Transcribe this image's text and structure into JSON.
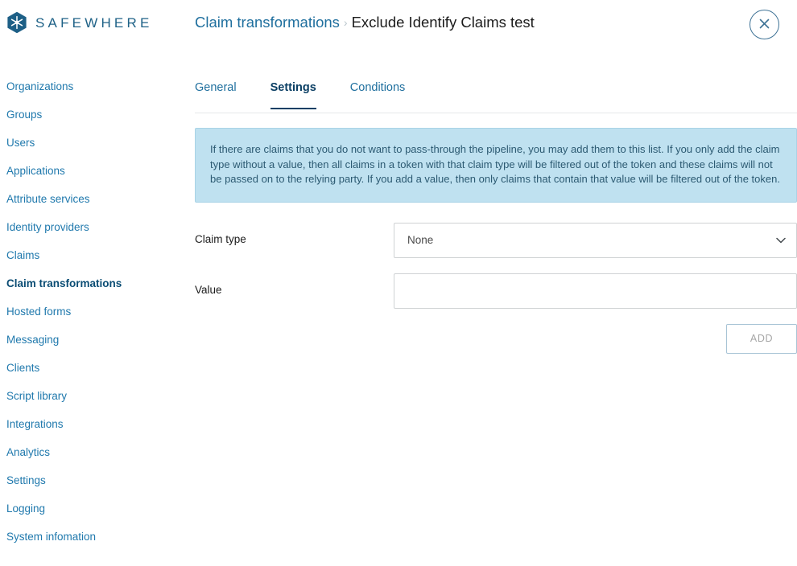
{
  "brand": {
    "logo_icon": "safewhere-hexagon-snowflake-icon",
    "wordmark": "SAFEWHERE"
  },
  "header": {
    "breadcrumb": {
      "parent": "Claim transformations",
      "separator": "›",
      "current": "Exclude Identify Claims test"
    },
    "close_icon": "close-icon"
  },
  "sidebar": {
    "items": [
      {
        "label": "Organizations",
        "active": false
      },
      {
        "label": "Groups",
        "active": false
      },
      {
        "label": "Users",
        "active": false
      },
      {
        "label": "Applications",
        "active": false
      },
      {
        "label": "Attribute services",
        "active": false
      },
      {
        "label": "Identity providers",
        "active": false
      },
      {
        "label": "Claims",
        "active": false
      },
      {
        "label": "Claim transformations",
        "active": true
      },
      {
        "label": "Hosted forms",
        "active": false
      },
      {
        "label": "Messaging",
        "active": false
      },
      {
        "label": "Clients",
        "active": false
      },
      {
        "label": "Script library",
        "active": false
      },
      {
        "label": "Integrations",
        "active": false
      },
      {
        "label": "Analytics",
        "active": false
      },
      {
        "label": "Settings",
        "active": false
      },
      {
        "label": "Logging",
        "active": false
      },
      {
        "label": "System infomation",
        "active": false
      }
    ]
  },
  "main": {
    "tabs": [
      {
        "label": "General",
        "active": false
      },
      {
        "label": "Settings",
        "active": true
      },
      {
        "label": "Conditions",
        "active": false
      }
    ],
    "info_box": {
      "text": "If there are claims that you do not want to pass-through the pipeline, you may add them to this list. If you only add the claim type without a value, then all claims in a token with that claim type will be filtered out of the token and these claims will not be passed on to the relying party. If you add a value, then only claims that contain that value will be filtered out of the token."
    },
    "form": {
      "claim_type": {
        "label": "Claim type",
        "value": "None",
        "chevron_icon": "chevron-down-icon"
      },
      "value_field": {
        "label": "Value",
        "value": "",
        "placeholder": ""
      },
      "add_button": "ADD"
    }
  },
  "colors": {
    "brand_blue": "#1f6287",
    "link_blue": "#2079ad",
    "active_navy": "#0b3f64",
    "info_bg": "#bfe1f0",
    "info_border": "#a9d3e6",
    "info_text": "#2c5a72",
    "field_border": "#cfd2d4",
    "add_border": "#a8c4d6",
    "add_text": "#a6a6a6"
  }
}
